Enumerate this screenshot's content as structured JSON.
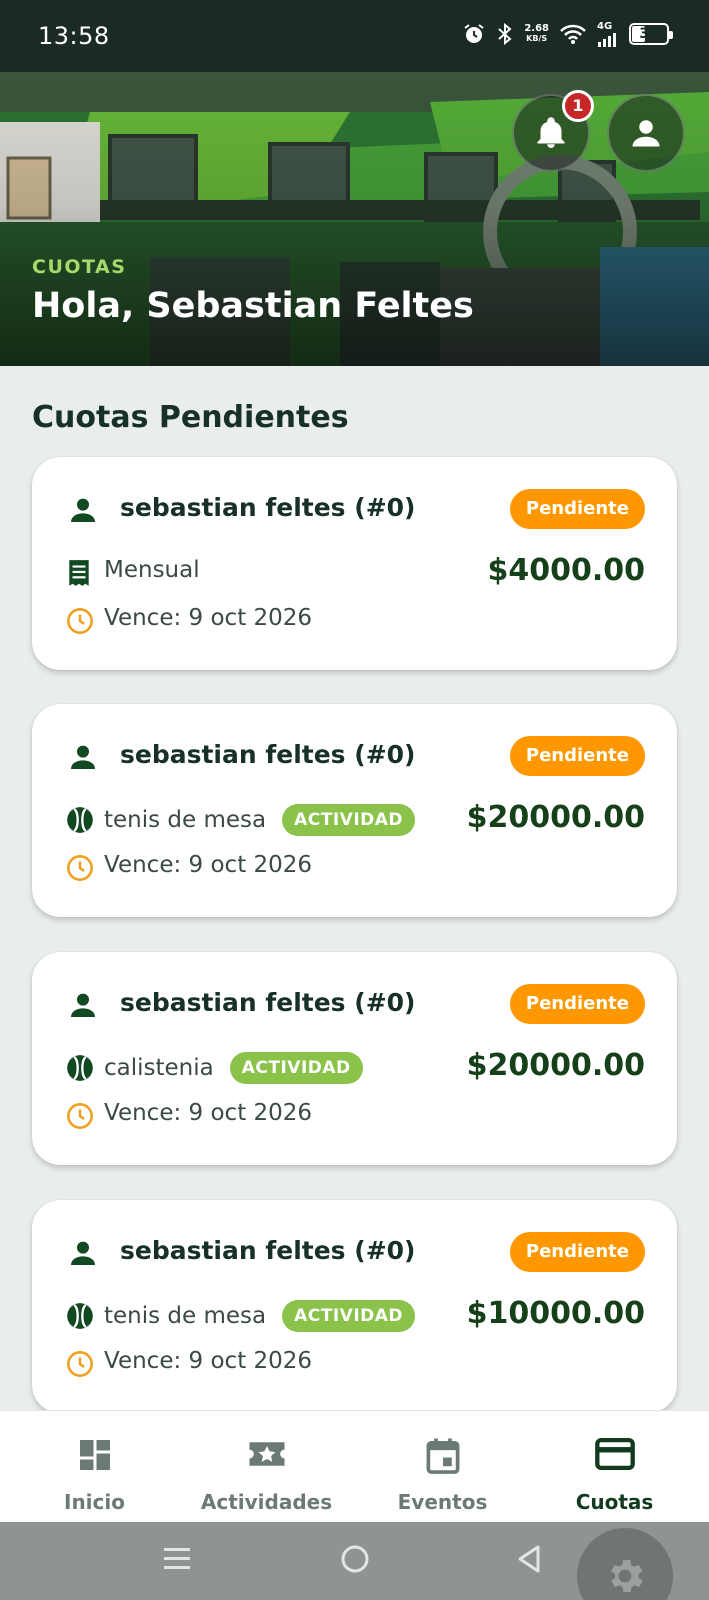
{
  "status_bar": {
    "time": "13:58",
    "net_speed_value": "2.68",
    "net_speed_unit": "KB/S",
    "network": "4G",
    "battery": "39",
    "icons": [
      "alarm-icon",
      "bluetooth-icon",
      "wifi-icon",
      "signal-icon",
      "battery-icon"
    ]
  },
  "header": {
    "kicker": "CUOTAS",
    "greeting": "Hola, Sebastian Feltes",
    "notification_count": "1"
  },
  "section": {
    "title": "Cuotas Pendientes"
  },
  "cards": [
    {
      "name": "sebastian feltes (#0)",
      "status": "Pendiente",
      "type": "Mensual",
      "tag": "",
      "type_icon": "receipt-icon",
      "amount": "$4000.00",
      "due": "Vence: 9 oct 2026"
    },
    {
      "name": "sebastian feltes (#0)",
      "status": "Pendiente",
      "type": "tenis de mesa",
      "tag": "ACTIVIDAD",
      "type_icon": "ball-icon",
      "amount": "$20000.00",
      "due": "Vence: 9 oct 2026"
    },
    {
      "name": "sebastian feltes (#0)",
      "status": "Pendiente",
      "type": "calistenia",
      "tag": "ACTIVIDAD",
      "type_icon": "ball-icon",
      "amount": "$20000.00",
      "due": "Vence: 9 oct 2026"
    },
    {
      "name": "sebastian feltes (#0)",
      "status": "Pendiente",
      "type": "tenis de mesa",
      "tag": "ACTIVIDAD",
      "type_icon": "ball-icon",
      "amount": "$10000.00",
      "due": "Vence: 9 oct 2026"
    }
  ],
  "bottom_nav": {
    "items": [
      {
        "label": "Inicio",
        "icon": "dashboard-icon"
      },
      {
        "label": "Actividades",
        "icon": "ticket-star-icon"
      },
      {
        "label": "Eventos",
        "icon": "calendar-icon"
      },
      {
        "label": "Cuotas",
        "icon": "credit-card-icon",
        "active": true
      }
    ]
  },
  "colors": {
    "accent_green": "#15401a",
    "kicker_green": "#a8d86b",
    "pending_orange": "#ff9800",
    "activity_green": "#8bc34a",
    "badge_red": "#c62828",
    "background": "#e9eeea"
  }
}
